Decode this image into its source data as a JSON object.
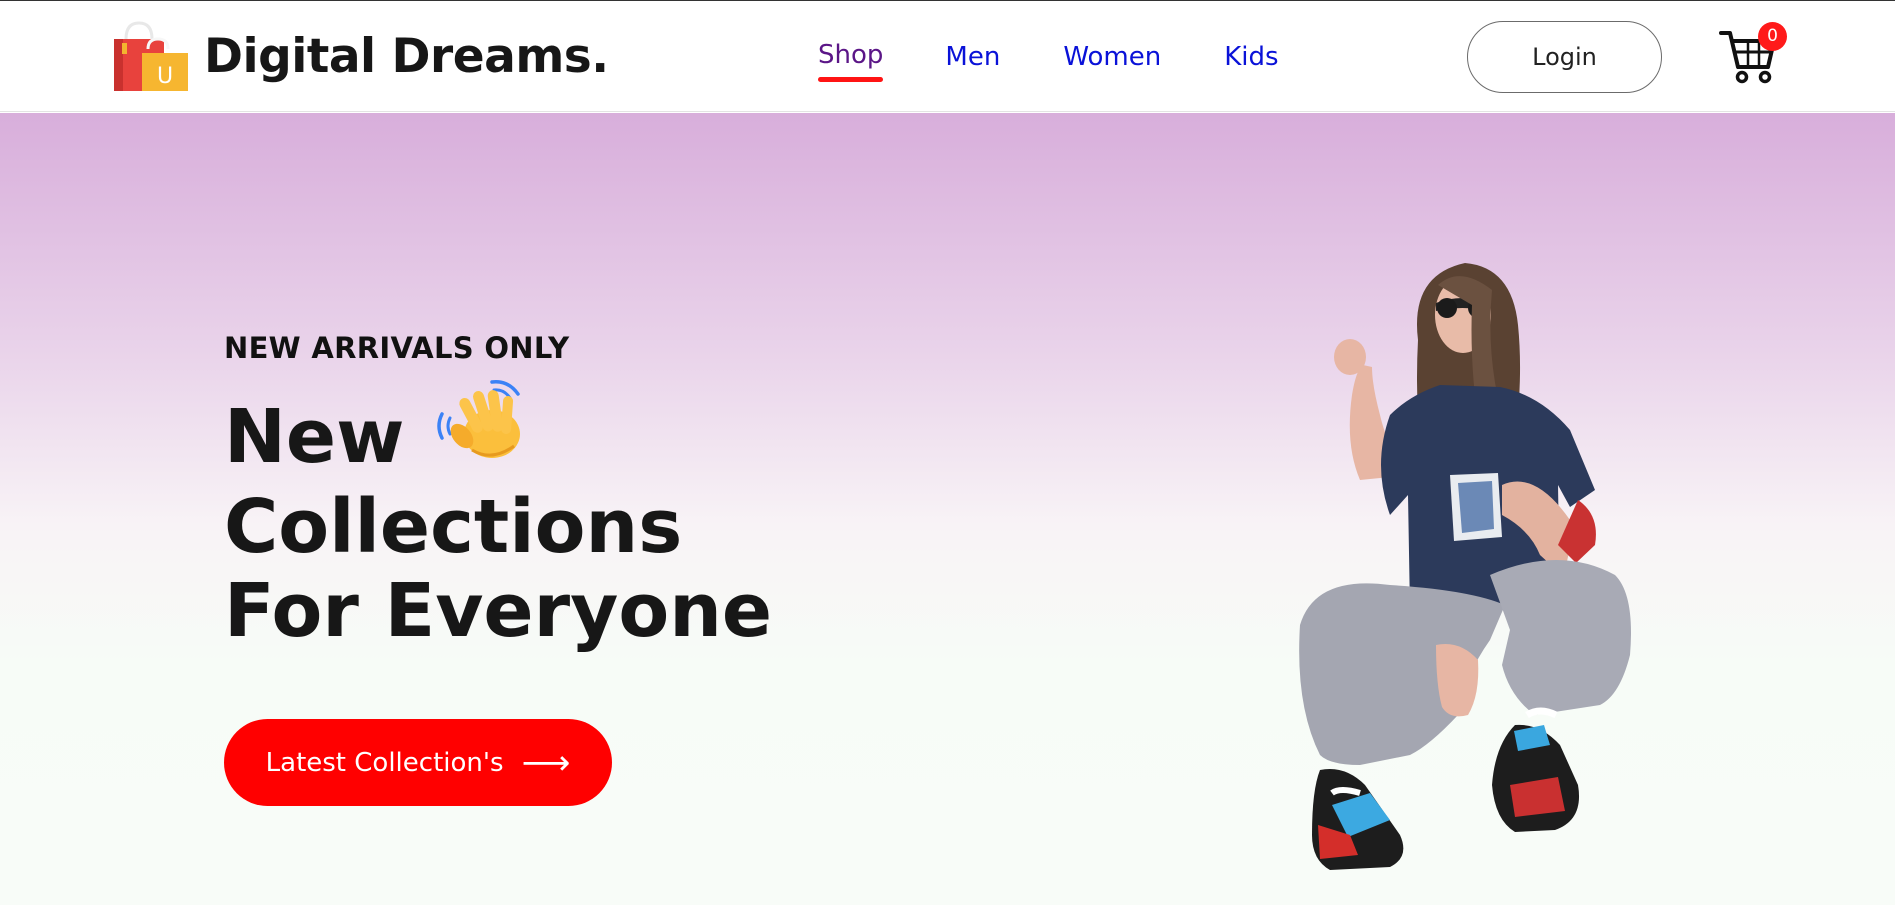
{
  "brand": {
    "name": "Digital Dreams.",
    "logo_icon": "shopping-bags-icon",
    "logo_letter": "U"
  },
  "nav": {
    "items": [
      {
        "label": "Shop",
        "active": true
      },
      {
        "label": "Men",
        "active": false
      },
      {
        "label": "Women",
        "active": false
      },
      {
        "label": "Kids",
        "active": false
      }
    ]
  },
  "header": {
    "login_label": "Login",
    "cart_icon": "cart-icon",
    "cart_count": "0"
  },
  "hero": {
    "eyebrow": "NEW ARRIVALS ONLY",
    "headline_line1": "New",
    "headline_line2": "Collections",
    "headline_line3": "For Everyone",
    "headline_icon": "waving-hand-icon",
    "cta_label": "Latest Collection's",
    "cta_icon": "arrow-right-icon",
    "image_subject": "hero-model-image"
  },
  "colors": {
    "accent": "#ff0000",
    "nav_link": "#0a12d8",
    "nav_active": "#5b1687",
    "hero_top": "#d8aedb",
    "hero_bottom": "#f8fcf8"
  }
}
